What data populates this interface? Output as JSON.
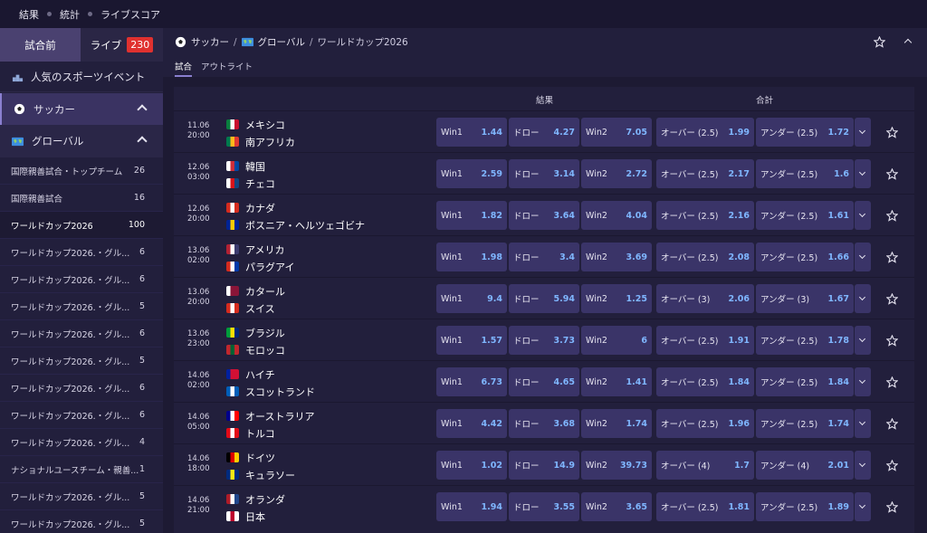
{
  "topnav": [
    "結果",
    "統計",
    "ライブスコア"
  ],
  "sidebar": {
    "tab_prematch": "試合前",
    "tab_live": "ライブ",
    "live_count": "230",
    "popular": "人気のスポーツイベント",
    "sport": "サッカー",
    "region": "グローバル",
    "items": [
      {
        "label": "国際親善試合・トップチーム",
        "count": "26"
      },
      {
        "label": "国際親善試合",
        "count": "16"
      },
      {
        "label": "ワールドカップ2026",
        "count": "100"
      },
      {
        "label": "ワールドカップ2026.・グル...",
        "count": "6"
      },
      {
        "label": "ワールドカップ2026.・グル...",
        "count": "6"
      },
      {
        "label": "ワールドカップ2026.・グル...",
        "count": "5"
      },
      {
        "label": "ワールドカップ2026.・グル...",
        "count": "6"
      },
      {
        "label": "ワールドカップ2026.・グル...",
        "count": "5"
      },
      {
        "label": "ワールドカップ2026.・グル...",
        "count": "6"
      },
      {
        "label": "ワールドカップ2026.・グル...",
        "count": "6"
      },
      {
        "label": "ワールドカップ2026.・グル...",
        "count": "4"
      },
      {
        "label": "ナショナルユースチーム・親善...",
        "count": "1"
      },
      {
        "label": "ワールドカップ2026.・グル...",
        "count": "5"
      },
      {
        "label": "ワールドカップ2026.・グル...",
        "count": "5"
      }
    ]
  },
  "breadcrumb": {
    "sport": "サッカー",
    "sep1": "/",
    "region": "グローバル",
    "sep2": "/",
    "league": "ワールドカップ2026"
  },
  "tabs": [
    "試合",
    "アウトライト"
  ],
  "columns": {
    "result": "結果",
    "total": "合計"
  },
  "matches": [
    {
      "date": "11.06",
      "time": "20:00",
      "home": "メキシコ",
      "away": "南アフリカ",
      "home_flag": [
        "#0a7f3f",
        "#ffffff",
        "#c8102e"
      ],
      "away_flag": [
        "#007a4d",
        "#ffb81c",
        "#de3831"
      ],
      "win1": "1.44",
      "draw": "4.27",
      "win2": "7.05",
      "over_label": "オーバー (2.5)",
      "over": "1.99",
      "under_label": "アンダー (2.5)",
      "under": "1.72"
    },
    {
      "date": "12.06",
      "time": "03:00",
      "home": "韓国",
      "away": "チェコ",
      "home_flag": [
        "#ffffff",
        "#cd2e3a",
        "#0047a0"
      ],
      "away_flag": [
        "#ffffff",
        "#d7141a",
        "#11457e"
      ],
      "win1": "2.59",
      "draw": "3.14",
      "win2": "2.72",
      "over_label": "オーバー (2.5)",
      "over": "2.17",
      "under_label": "アンダー (2.5)",
      "under": "1.6"
    },
    {
      "date": "12.06",
      "time": "20:00",
      "home": "カナダ",
      "away": "ボスニア・ヘルツェゴビナ",
      "home_flag": [
        "#d52b1e",
        "#ffffff",
        "#d52b1e"
      ],
      "away_flag": [
        "#002395",
        "#fecb00",
        "#002395"
      ],
      "win1": "1.82",
      "draw": "3.64",
      "win2": "4.04",
      "over_label": "オーバー (2.5)",
      "over": "2.16",
      "under_label": "アンダー (2.5)",
      "under": "1.61"
    },
    {
      "date": "13.06",
      "time": "02:00",
      "home": "アメリカ",
      "away": "パラグアイ",
      "home_flag": [
        "#b22234",
        "#ffffff",
        "#3c3b6e"
      ],
      "away_flag": [
        "#d52b1e",
        "#ffffff",
        "#0038a8"
      ],
      "win1": "1.98",
      "draw": "3.4",
      "win2": "3.69",
      "over_label": "オーバー (2.5)",
      "over": "2.08",
      "under_label": "アンダー (2.5)",
      "under": "1.66"
    },
    {
      "date": "13.06",
      "time": "20:00",
      "home": "カタール",
      "away": "スイス",
      "home_flag": [
        "#ffffff",
        "#8a1538",
        "#8a1538"
      ],
      "away_flag": [
        "#d52b1e",
        "#ffffff",
        "#d52b1e"
      ],
      "win1": "9.4",
      "draw": "5.94",
      "win2": "1.25",
      "over_label": "オーバー (3)",
      "over": "2.06",
      "under_label": "アンダー (3)",
      "under": "1.67"
    },
    {
      "date": "13.06",
      "time": "23:00",
      "home": "ブラジル",
      "away": "モロッコ",
      "home_flag": [
        "#009c3b",
        "#ffdf00",
        "#002776"
      ],
      "away_flag": [
        "#c1272d",
        "#006233",
        "#c1272d"
      ],
      "win1": "1.57",
      "draw": "3.73",
      "win2": "6",
      "over_label": "オーバー (2.5)",
      "over": "1.91",
      "under_label": "アンダー (2.5)",
      "under": "1.78"
    },
    {
      "date": "14.06",
      "time": "02:00",
      "home": "ハイチ",
      "away": "スコットランド",
      "home_flag": [
        "#00209f",
        "#d21034",
        "#d21034"
      ],
      "away_flag": [
        "#005eb8",
        "#ffffff",
        "#005eb8"
      ],
      "win1": "6.73",
      "draw": "4.65",
      "win2": "1.41",
      "over_label": "オーバー (2.5)",
      "over": "1.84",
      "under_label": "アンダー (2.5)",
      "under": "1.84"
    },
    {
      "date": "14.06",
      "time": "05:00",
      "home": "オーストラリア",
      "away": "トルコ",
      "home_flag": [
        "#00008b",
        "#ffffff",
        "#ff0000"
      ],
      "away_flag": [
        "#e30a17",
        "#ffffff",
        "#e30a17"
      ],
      "win1": "4.42",
      "draw": "3.68",
      "win2": "1.74",
      "over_label": "オーバー (2.5)",
      "over": "1.96",
      "under_label": "アンダー (2.5)",
      "under": "1.74"
    },
    {
      "date": "14.06",
      "time": "18:00",
      "home": "ドイツ",
      "away": "キュラソー",
      "home_flag": [
        "#000000",
        "#dd0000",
        "#ffce00"
      ],
      "away_flag": [
        "#002b7f",
        "#f9e814",
        "#002b7f"
      ],
      "win1": "1.02",
      "draw": "14.9",
      "win2": "39.73",
      "over_label": "オーバー (4)",
      "over": "1.7",
      "under_label": "アンダー (4)",
      "under": "2.01"
    },
    {
      "date": "14.06",
      "time": "21:00",
      "home": "オランダ",
      "away": "日本",
      "home_flag": [
        "#ae1c28",
        "#ffffff",
        "#21468b"
      ],
      "away_flag": [
        "#ffffff",
        "#bc002d",
        "#ffffff"
      ],
      "win1": "1.94",
      "draw": "3.55",
      "win2": "3.65",
      "over_label": "オーバー (2.5)",
      "over": "1.81",
      "under_label": "アンダー (2.5)",
      "under": "1.89"
    }
  ],
  "odds_labels": {
    "win1": "Win1",
    "draw": "ドロー",
    "win2": "Win2"
  },
  "colors": {
    "accent": "#8a7fd0",
    "odd_bg": "#3a3468",
    "odd_value": "#7fb6ff",
    "badge": "#e0312f"
  }
}
